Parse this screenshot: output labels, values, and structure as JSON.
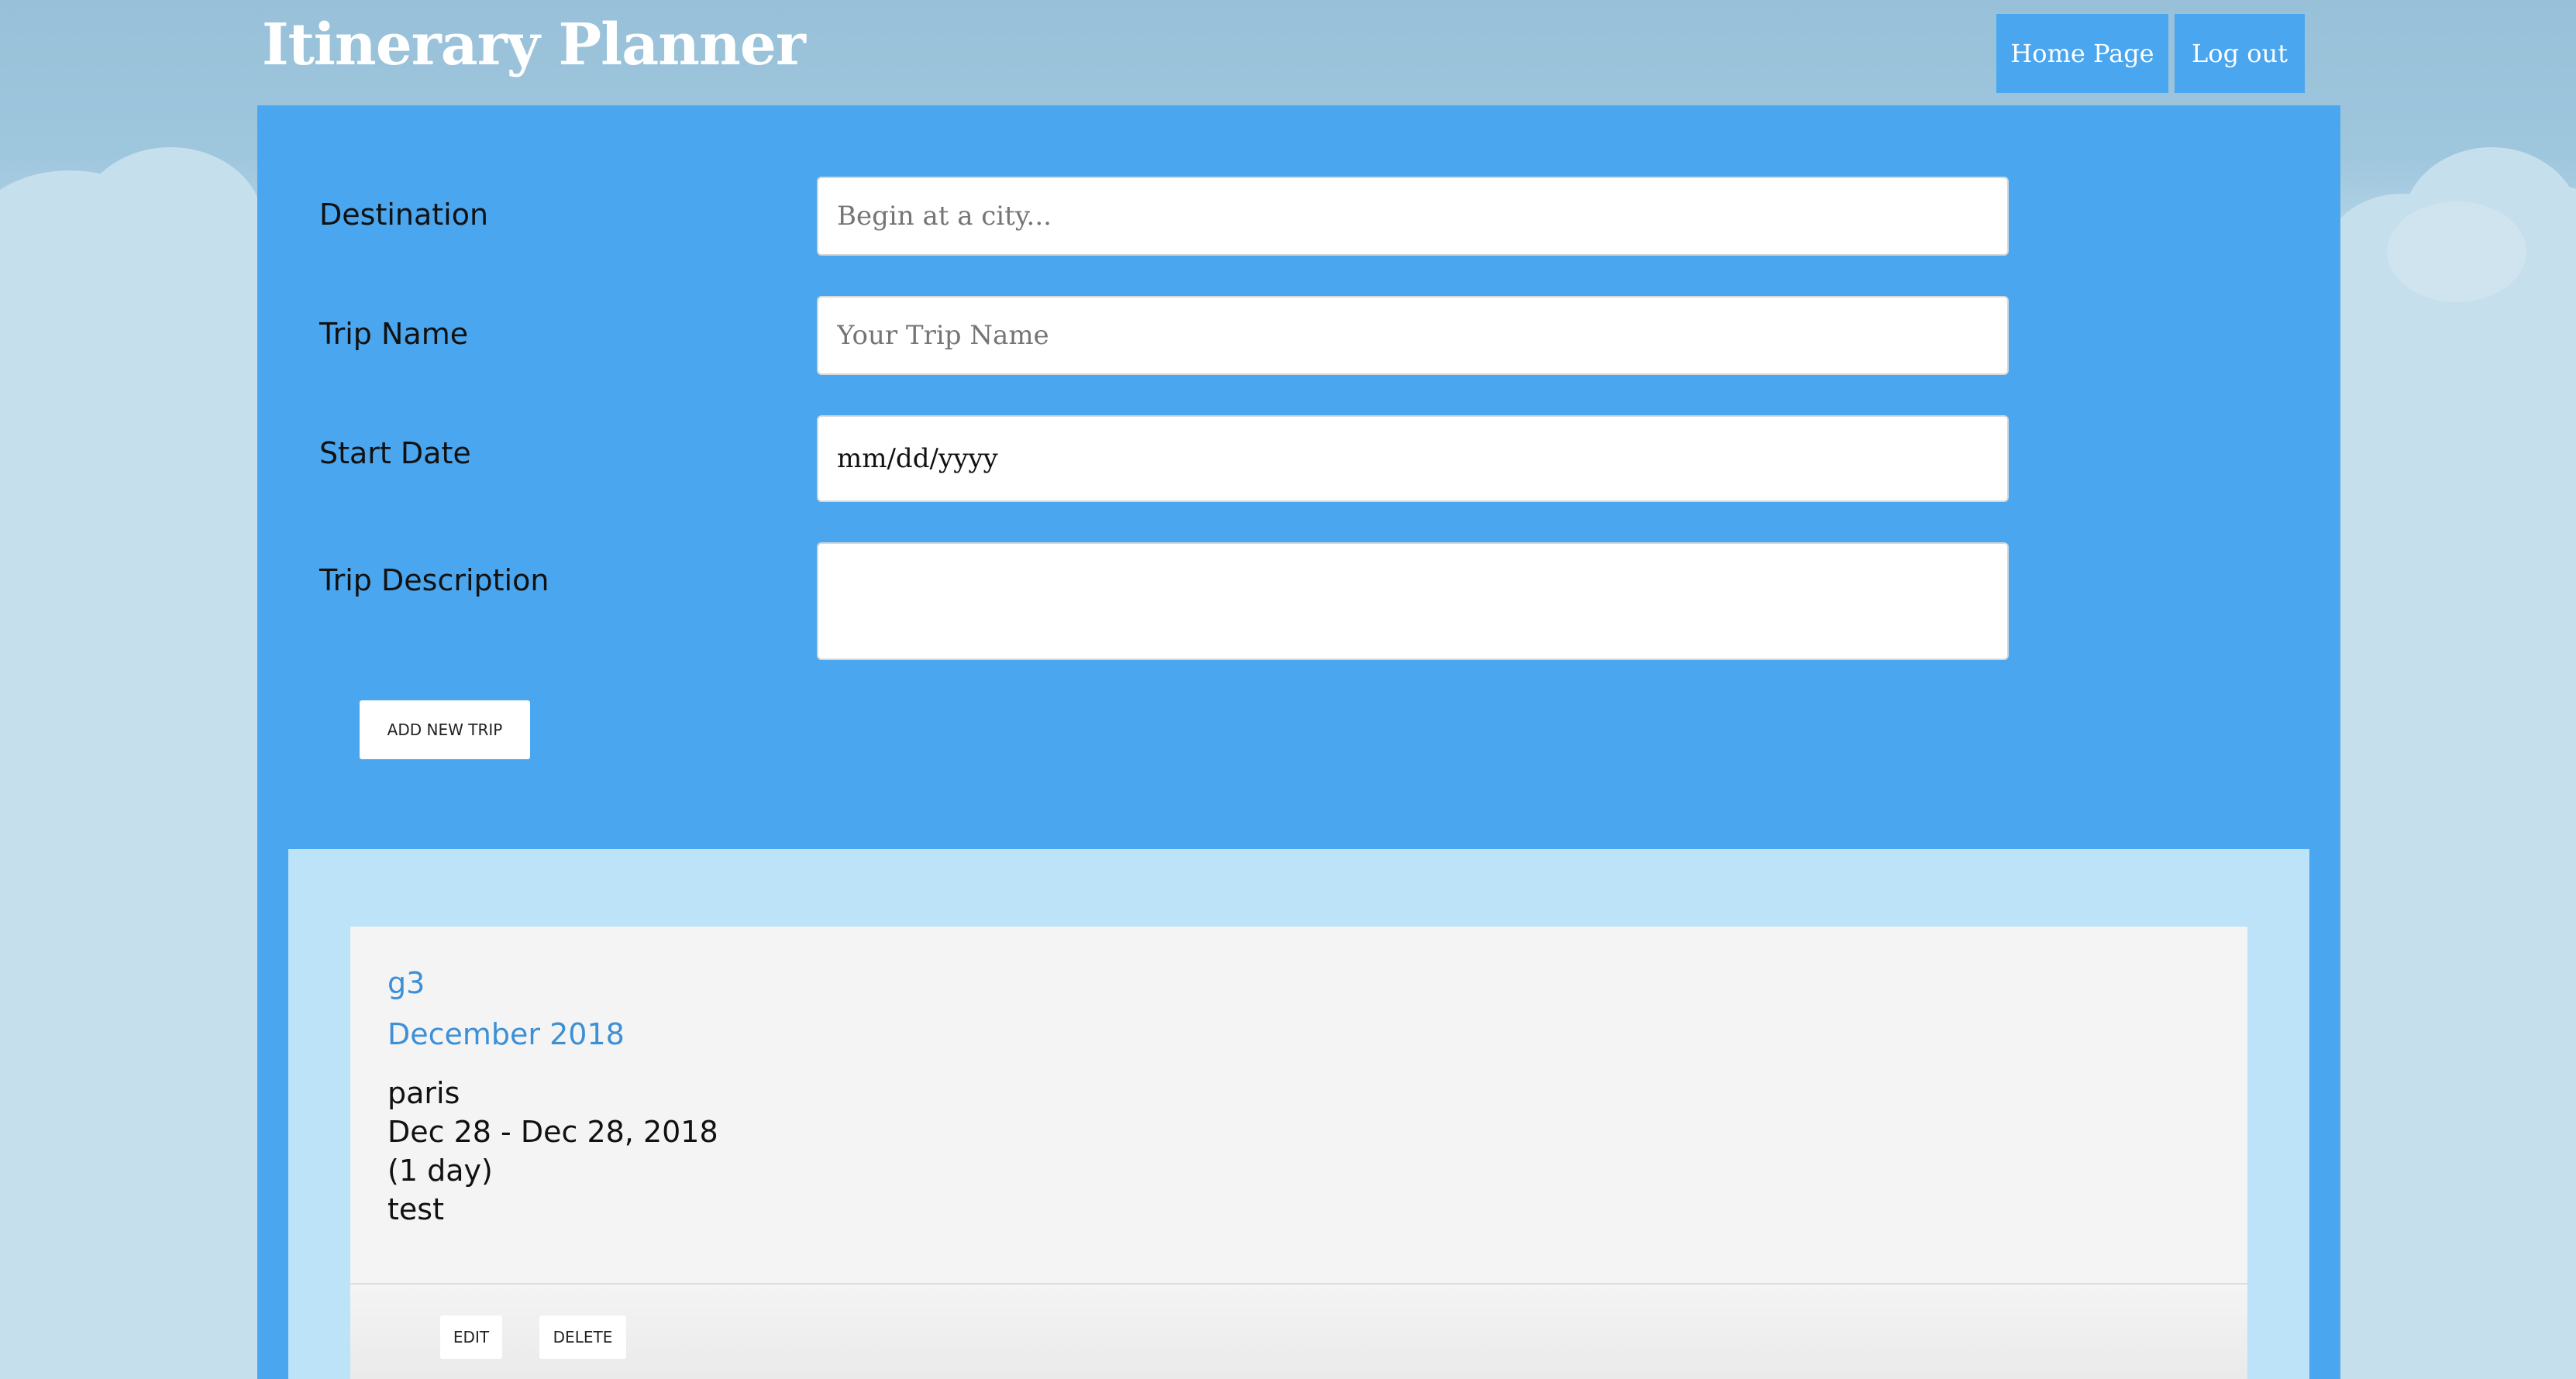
{
  "header": {
    "title": "Itinerary Planner",
    "nav": {
      "home_label": "Home Page",
      "logout_label": "Log out"
    }
  },
  "form": {
    "destination": {
      "label": "Destination",
      "placeholder": "Begin at a city...",
      "value": ""
    },
    "trip_name": {
      "label": "Trip Name",
      "placeholder": "Your Trip Name",
      "value": ""
    },
    "start_date": {
      "label": "Start Date",
      "value": "mm/dd/yyyy"
    },
    "description": {
      "label": "Trip Description",
      "value": ""
    },
    "submit_label": "ADD NEW TRIP"
  },
  "trips": [
    {
      "name": "g3",
      "month": "December 2018",
      "city": "paris",
      "date_range": "Dec 28 - Dec 28, 2018",
      "duration": "(1 day)",
      "description": "test",
      "edit_label": "EDIT",
      "delete_label": "DELETE"
    }
  ],
  "colors": {
    "panel": "#4aa6ee",
    "trips_area": "#bce3f7",
    "card": "#f4f4f4",
    "accent_text": "#3d8fd6",
    "sky": "#9ac3da"
  }
}
